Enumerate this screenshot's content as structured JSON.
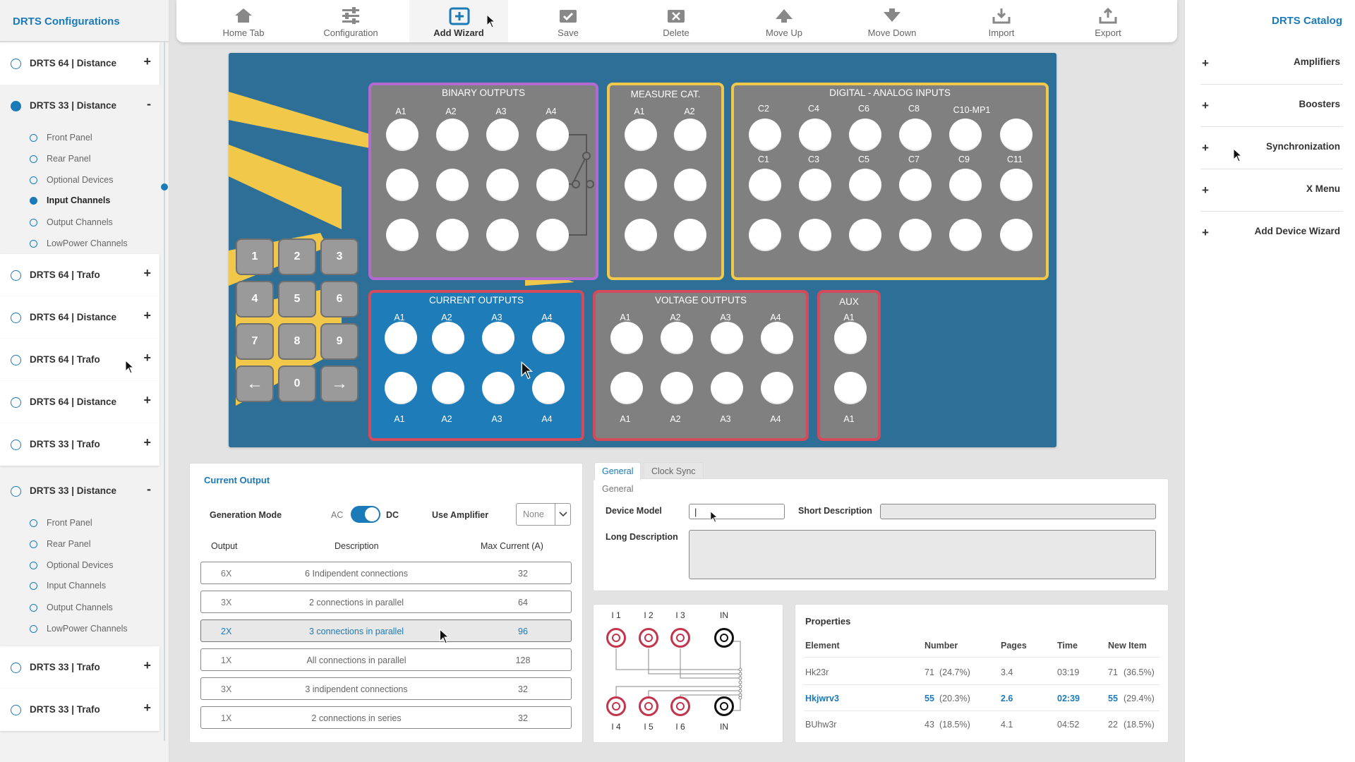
{
  "left_sidebar": {
    "title": "DRTS Configurations",
    "groups": [
      {
        "label": "DRTS 64 | Distance",
        "toggle": "+"
      },
      {
        "label": "DRTS 33 | Distance",
        "toggle": "-",
        "children": [
          "Front Panel",
          "Rear Panel",
          "Optional Devices",
          "Input Channels",
          "Output Channels",
          "LowPower Channels"
        ],
        "active_child": "Input Channels"
      },
      {
        "label": "DRTS 64 | Trafo",
        "toggle": "+"
      },
      {
        "label": "DRTS 64 | Distance",
        "toggle": "+"
      },
      {
        "label": "DRTS 64 | Trafo",
        "toggle": "+"
      },
      {
        "label": "DRTS 64 | Distance",
        "toggle": "+"
      },
      {
        "label": "DRTS 33 | Trafo",
        "toggle": "+"
      },
      {
        "label": "DRTS 33 | Distance",
        "toggle": "-",
        "children": [
          "Front Panel",
          "Rear Panel",
          "Optional Devices",
          "Input Channels",
          "Output Channels",
          "LowPower Channels"
        ]
      },
      {
        "label": "DRTS 33 | Trafo",
        "toggle": "+"
      },
      {
        "label": "DRTS 33 | Trafo",
        "toggle": "+"
      }
    ]
  },
  "toolbar": {
    "items": [
      {
        "label": "Home Tab",
        "icon": "home-icon"
      },
      {
        "label": "Configuration",
        "icon": "sliders-icon"
      },
      {
        "label": "Add Wizard",
        "icon": "add-box-icon",
        "active": true
      },
      {
        "label": "Save",
        "icon": "save-check-icon"
      },
      {
        "label": "Delete",
        "icon": "delete-icon"
      },
      {
        "label": "Move Up",
        "icon": "arrow-up-icon"
      },
      {
        "label": "Move Down",
        "icon": "arrow-down-icon"
      },
      {
        "label": "Import",
        "icon": "import-icon"
      },
      {
        "label": "Export",
        "icon": "export-icon"
      }
    ]
  },
  "right_sidebar": {
    "title": "DRTS Catalog",
    "items": [
      {
        "label": "Amplifiers",
        "toggle": "+"
      },
      {
        "label": "Boosters",
        "toggle": "+"
      },
      {
        "label": "Synchronization",
        "toggle": "+"
      },
      {
        "label": "X Menu",
        "toggle": "+"
      },
      {
        "label": "Add Device Wizard",
        "toggle": "+"
      }
    ]
  },
  "device": {
    "binary_outputs": {
      "title": "BINARY OUTPUTS",
      "cols": [
        "A1",
        "A2",
        "A3",
        "A4"
      ]
    },
    "measure_cat": {
      "title": "MEASURE CAT.",
      "cols": [
        "A1",
        "A2"
      ]
    },
    "digital_analog": {
      "title": "DIGITAL - ANALOG INPUTS",
      "top_labels": [
        "C2",
        "C4",
        "C6",
        "C8",
        "C10-MP1"
      ],
      "mid_labels": [
        "C1",
        "C3",
        "C5",
        "C7",
        "C9",
        "C11"
      ]
    },
    "current_outputs": {
      "title": "CURRENT OUTPUTS",
      "cols": [
        "A1",
        "A2",
        "A3",
        "A4"
      ]
    },
    "voltage_outputs": {
      "title": "VOLTAGE OUTPUTS",
      "cols": [
        "A1",
        "A2",
        "A3",
        "A4"
      ]
    },
    "aux": {
      "title": "AUX",
      "cols": [
        "A1"
      ]
    },
    "keypad": [
      "1",
      "2",
      "3",
      "4",
      "5",
      "6",
      "7",
      "8",
      "9",
      "←",
      "0",
      "→"
    ],
    "colors": {
      "panel": "#2e6f97",
      "stripe": "#f2c84b",
      "binary_border": "#b26ad0",
      "output_border": "#d34a5a"
    }
  },
  "current_output": {
    "title": "Current Output",
    "generation_mode_label": "Generation Mode",
    "mode_ac": "AC",
    "mode_dc": "DC",
    "use_amplifier_label": "Use Amplifier",
    "amplifier_value": "None",
    "headers": [
      "Output",
      "Description",
      "Max Current (A)"
    ],
    "rows": [
      {
        "output": "6X",
        "description": "6 Indipendent connections",
        "max": "32"
      },
      {
        "output": "3X",
        "description": "2 connections in parallel",
        "max": "64"
      },
      {
        "output": "2X",
        "description": "3 connections in parallel",
        "max": "96",
        "selected": true
      },
      {
        "output": "1X",
        "description": "All connections in parallel",
        "max": "128"
      },
      {
        "output": "3X",
        "description": "3 indipendent connections",
        "max": "32"
      },
      {
        "output": "1X",
        "description": "2 connections in series",
        "max": "32"
      }
    ]
  },
  "general": {
    "tabs": [
      "General",
      "Clock Sync"
    ],
    "section": "General",
    "device_model_label": "Device Model",
    "device_model_value": "|",
    "short_description_label": "Short Description",
    "long_description_label": "Long Description"
  },
  "wiring": {
    "top_labels": [
      "I 1",
      "I 2",
      "I 3",
      "IN"
    ],
    "bottom_labels": [
      "I 4",
      "I 5",
      "I 6",
      "IN"
    ]
  },
  "properties": {
    "title": "Properties",
    "headers": [
      "Element",
      "Number",
      "Pages",
      "Time",
      "New Item"
    ],
    "rows": [
      {
        "element": "Hk23r",
        "number": "71",
        "number_pct": "(24.7%)",
        "pages": "3.4",
        "time": "03:19",
        "new": "71",
        "new_pct": "(36.5%)"
      },
      {
        "element": "Hkjwrv3",
        "number": "55",
        "number_pct": "(20.3%)",
        "pages": "2.6",
        "time": "02:39",
        "new": "55",
        "new_pct": "(29.4%)",
        "highlight": true
      },
      {
        "element": "BUhw3r",
        "number": "43",
        "number_pct": "(18.5%)",
        "pages": "4.1",
        "time": "04:52",
        "new": "22",
        "new_pct": "(18.5%)"
      }
    ]
  }
}
